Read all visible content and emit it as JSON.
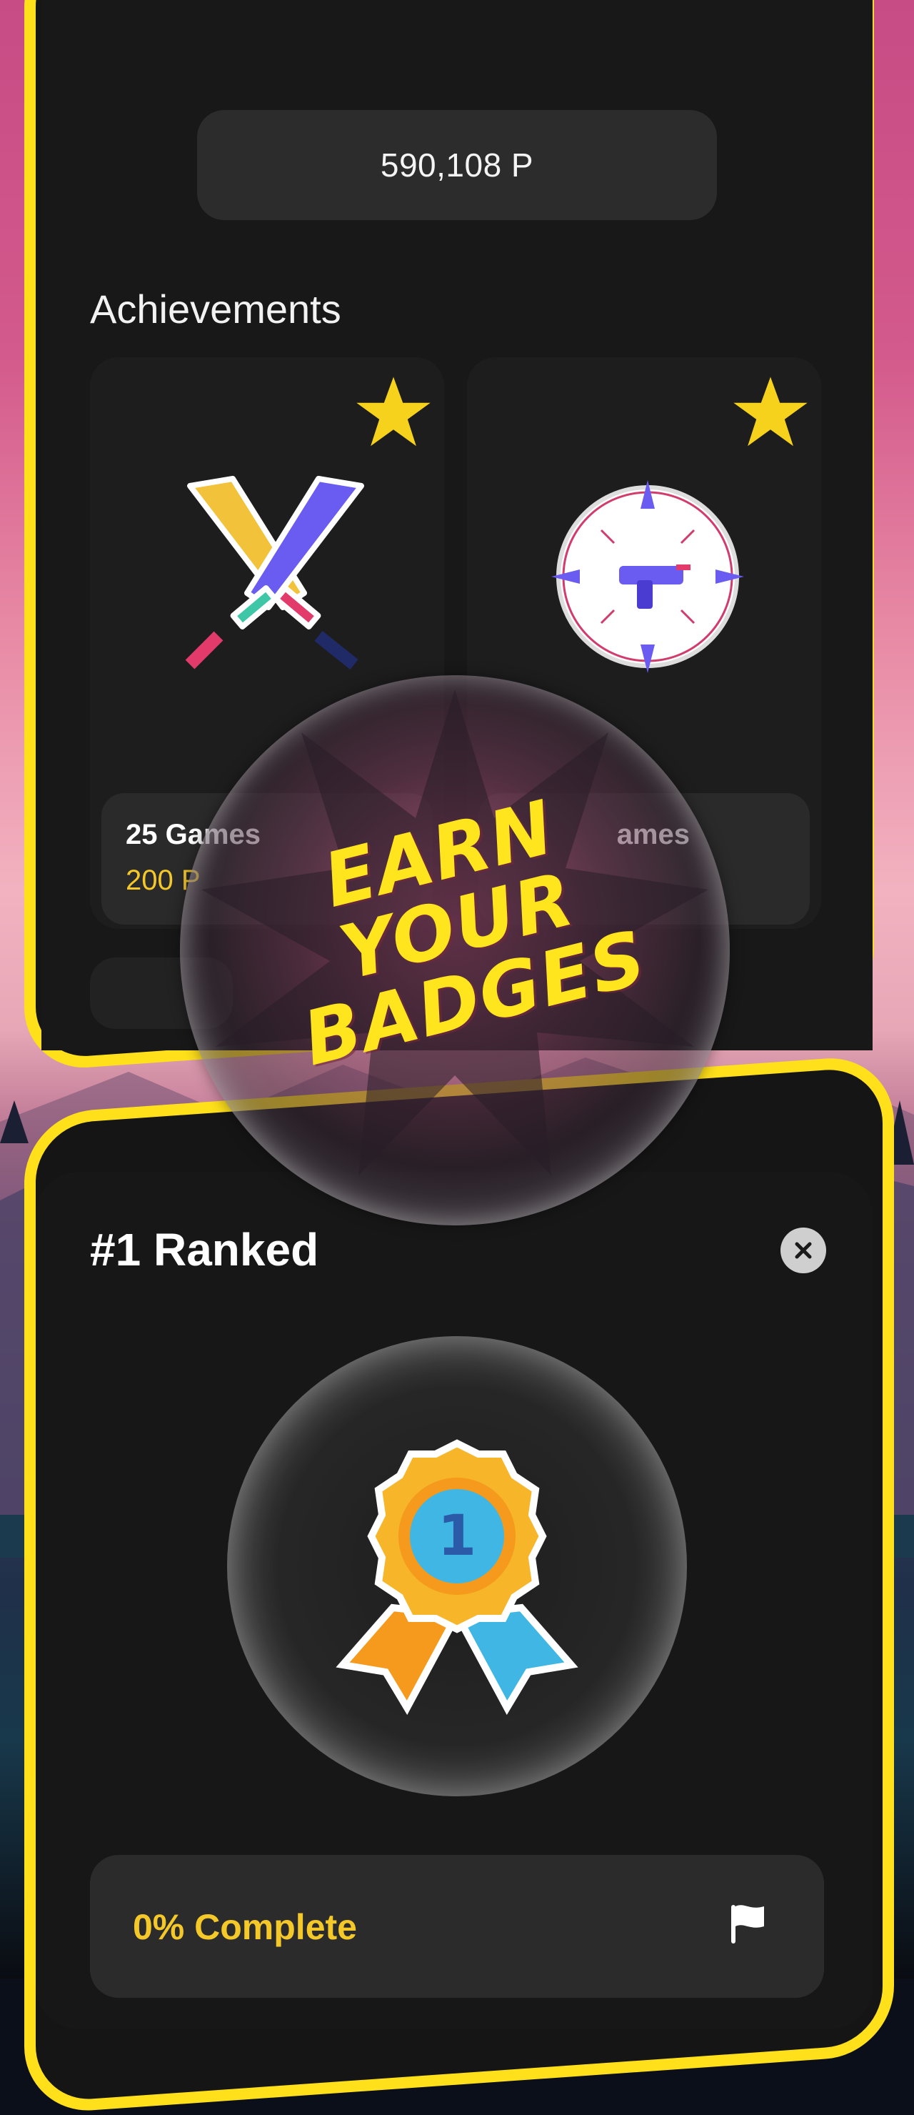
{
  "points_balance": "590,108 P",
  "achievements": {
    "title": "Achievements",
    "cards": [
      {
        "name": "25 Games",
        "points": "200 P",
        "icon": "crossed-swords-icon",
        "starred": true
      },
      {
        "name": "ames",
        "points": "",
        "icon": "crosshair-blaster-icon",
        "starred": true
      }
    ]
  },
  "promo": {
    "slogan_lines": [
      "EARN",
      "YOUR",
      "BADGES"
    ]
  },
  "detail": {
    "title": "#1 Ranked",
    "close_icon": "close-icon",
    "badge_icon": "rank-medal-icon",
    "badge_number": "1",
    "progress_label": "0% Complete",
    "progress_value": 0,
    "flag_icon": "flag-icon"
  },
  "colors": {
    "accent_yellow": "#ffe01b",
    "points_gold": "#f5c82a",
    "panel_dark": "#161616",
    "card_dark": "#1d1d1d"
  }
}
